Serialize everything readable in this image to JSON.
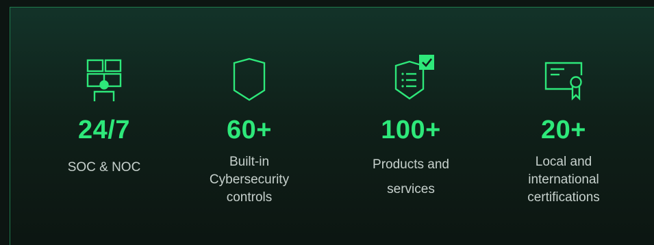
{
  "colors": {
    "accent": "#2ee87a",
    "text": "#c7d1cd",
    "panel_border": "#1f7a4d",
    "background": "#0d1512"
  },
  "stats": [
    {
      "icon": "monitor-wall-operator-icon",
      "value": "24/7",
      "label_lines": [
        "SOC & NOC"
      ]
    },
    {
      "icon": "shield-icon",
      "value": "60+",
      "label_lines": [
        "Built-in",
        "Cybersecurity",
        "controls"
      ]
    },
    {
      "icon": "shield-checklist-icon",
      "value": "100+",
      "label_lines": [
        "Products and",
        "services"
      ]
    },
    {
      "icon": "certificate-icon",
      "value": "20+",
      "label_lines": [
        "Local and",
        "international",
        "certifications"
      ]
    }
  ]
}
